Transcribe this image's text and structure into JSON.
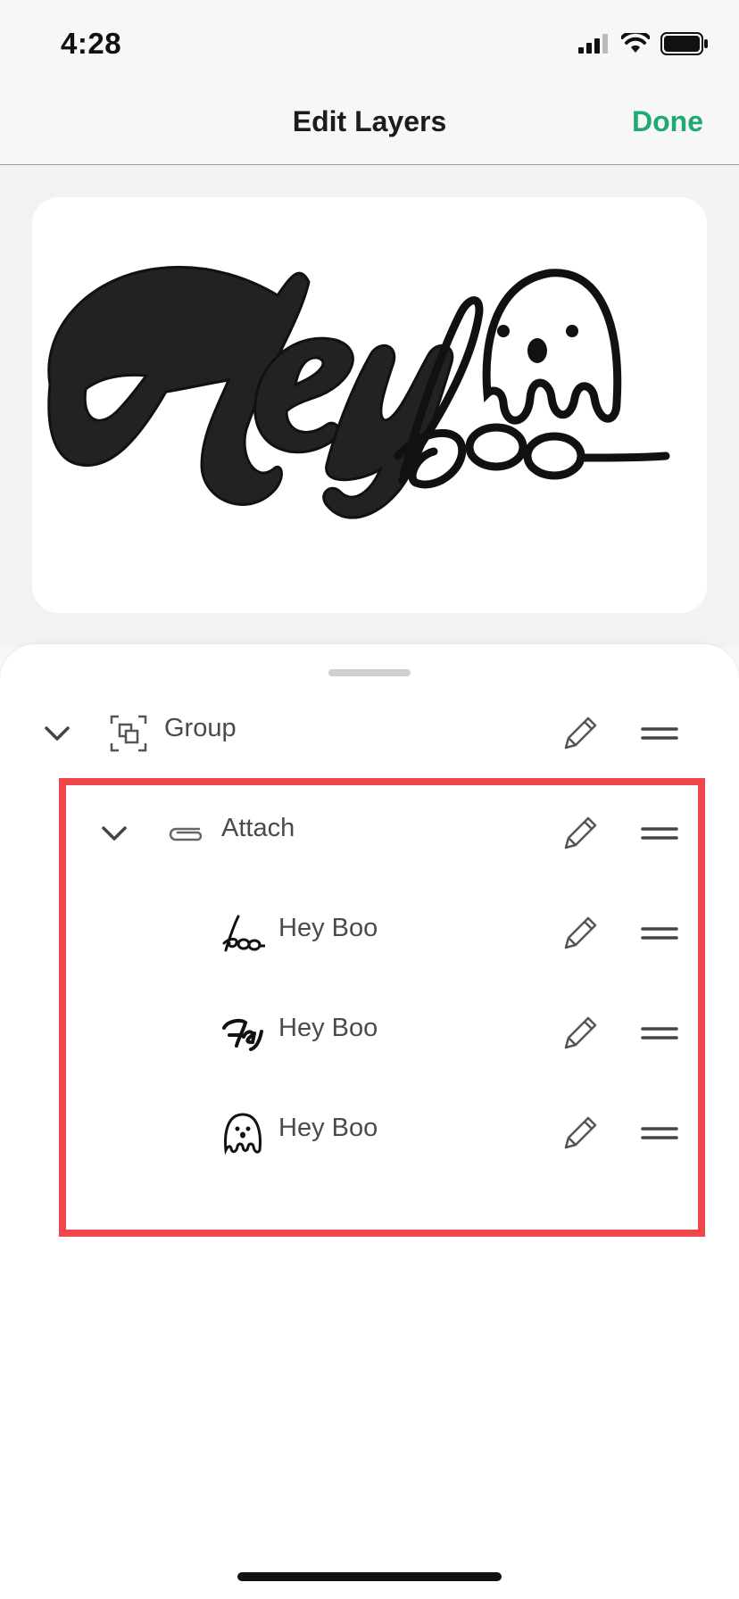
{
  "status_bar": {
    "time": "4:28",
    "icons": [
      "signal-icon",
      "wifi-icon",
      "battery-icon"
    ]
  },
  "nav": {
    "title": "Edit Layers",
    "done_label": "Done",
    "accent_color": "#1eaa72"
  },
  "preview": {
    "artwork": "hey-boo-ghost-artwork"
  },
  "layers": [
    {
      "label": "Group",
      "icon": "group-icon",
      "expanded": true,
      "level": 0
    },
    {
      "label": "Attach",
      "icon": "attach-icon",
      "expanded": true,
      "level": 1
    },
    {
      "label": "Hey Boo",
      "icon": "boo-thumbnail-icon",
      "level": 2
    },
    {
      "label": "Hey Boo",
      "icon": "hey-thumbnail-icon",
      "level": 2
    },
    {
      "label": "Hey Boo",
      "icon": "ghost-thumbnail-icon",
      "level": 2
    }
  ],
  "highlight_color": "#f0474d"
}
